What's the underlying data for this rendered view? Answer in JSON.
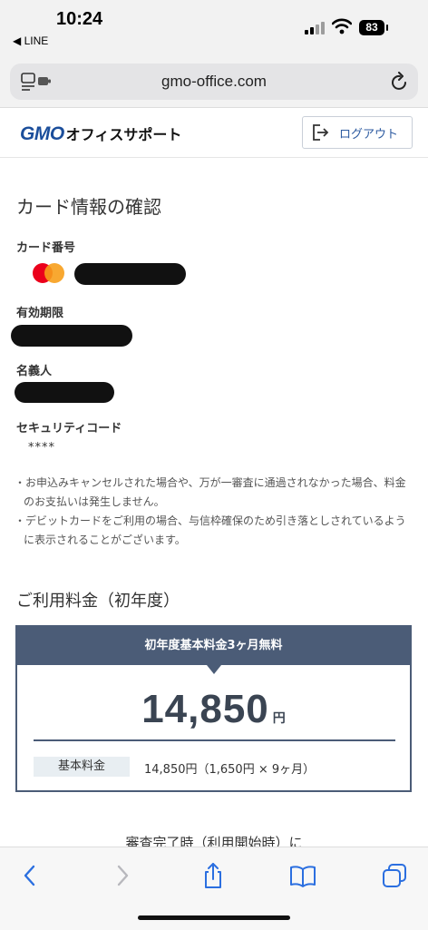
{
  "status_bar": {
    "time": "10:24",
    "back_app": "◀ LINE",
    "battery": "83"
  },
  "browser": {
    "url": "gmo-office.com"
  },
  "header": {
    "logo_main": "GMO",
    "logo_sub": "オフィスサポート",
    "logout_label": "ログアウト"
  },
  "main": {
    "title": "カード情報の確認",
    "card_number_label": "カード番号",
    "expiry_label": "有効期限",
    "holder_label": "名義人",
    "security_label": "セキュリティコード",
    "security_value": "****",
    "notes": [
      "・お申込みキャンセルされた場合や、万が一審査に通過されなかった場合、料金のお支払いは発生しません。",
      "・デビットカードをご利用の場合、与信枠確保のため引き落としされているように表示されることがございます。"
    ]
  },
  "pricing": {
    "section_title": "ご利用料金（初年度）",
    "banner": "初年度基本料金3ヶ月無料",
    "amount": "14,850",
    "currency": "円",
    "fee_label": "基本料金",
    "fee_detail": "14,850円（1,650円 × 9ヶ月）"
  },
  "partial_text": "審査完了時（利用開始時）に"
}
